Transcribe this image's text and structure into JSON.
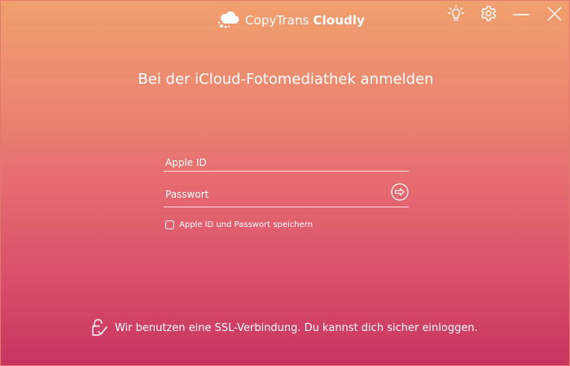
{
  "app": {
    "brand_light": "CopyTrans ",
    "brand_bold": "Cloudly",
    "logo_icon": "cloud-icon"
  },
  "titlebar": {
    "tip_icon": "lightbulb-icon",
    "settings_icon": "gear-icon",
    "minimize_icon": "minimize-icon",
    "close_icon": "close-icon"
  },
  "main": {
    "heading": "Bei der iCloud-Fotomediathek anmelden",
    "apple_id": {
      "placeholder": "Apple ID",
      "value": ""
    },
    "password": {
      "placeholder": "Passwort",
      "value": ""
    },
    "submit_icon": "arrow-right-icon",
    "remember": {
      "label": "Apple ID und Passwort speichern",
      "checked": false
    }
  },
  "footer": {
    "lock_icon": "lock-check-icon",
    "text": "Wir benutzen eine SSL-Verbindung. Du kannst dich sicher einloggen."
  },
  "colors": {
    "gradient_top": "#f0a06e",
    "gradient_bottom": "#c8345f",
    "text": "#ffffff"
  }
}
